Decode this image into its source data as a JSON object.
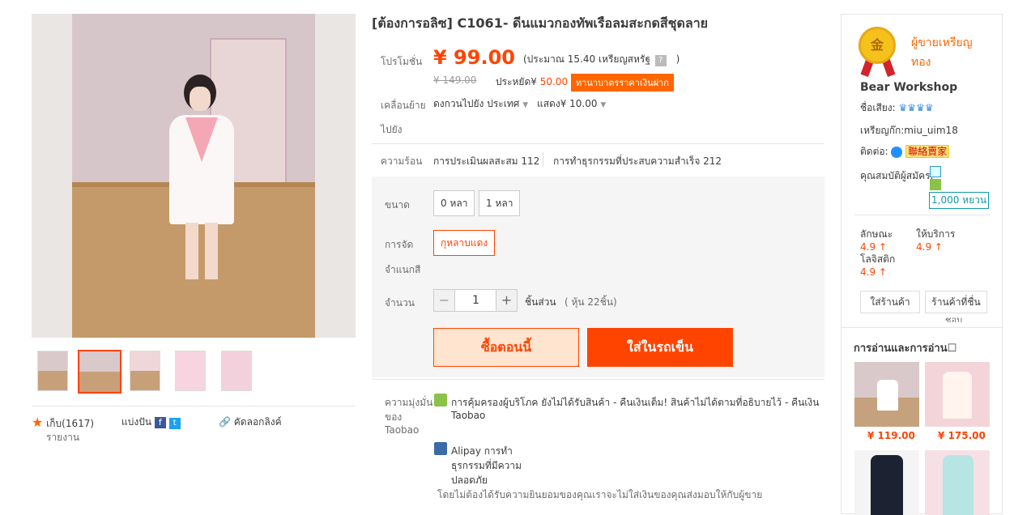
{
  "title": "[ต้องการอลิซ] C1061- ดีนแมวกองทัพเรือลมสะกดสีชุดลาย",
  "price": {
    "promo_label": "โปรโมชั่น",
    "current": "¥ 99.00",
    "approx": "(ประมาณ 15.40 เหรียญสหรัฐ",
    "approx_close": ")",
    "help": "?",
    "original": "¥ 149.00",
    "save_label": "ประหยัด¥",
    "save_value": "50.00",
    "deposit_tag": "ทานาบาตรราคาเงินฝาก"
  },
  "shipping": {
    "label": "เคลื่อนย้าย",
    "label2": "ไปยัง",
    "dest": "ดงกวนไปยัง ประเทศ",
    "fee": "แสดง¥ 10.00"
  },
  "popularity": {
    "label": "ความร้อน",
    "reviews": "การประเมินผลสะสม 112",
    "sales": "การทำธุรกรรมที่ประสบความสำเร็จ 212"
  },
  "sku": {
    "size_label": "ขนาด",
    "sizes": [
      "0 หลา",
      "1 หลา"
    ],
    "color_label": "การจัด",
    "color_label2": "จำแนกสี",
    "color_value": "กุหลาบแดง",
    "qty_label": "จำนวน",
    "qty_value": "1",
    "qty_minus": "−",
    "qty_plus": "+",
    "unit": "ชิ้นส่วน",
    "stock": "( หุ้น 22ชิ้น)"
  },
  "buttons": {
    "buy_now": "ซื้อตอนนี้",
    "add_cart": "ใส่ในรถเข็น"
  },
  "promise": {
    "label1": "ความมุ่งมั่น",
    "label2": "ของ",
    "label3": "Taobao",
    "item1": "การคุ้มครองผู้บริโภค   ยังไม่ได้รับสินค้า - คืนเงินเต็ม! สินค้าไม่ได้ตามที่อธิบายไว้ - คืนเงิน",
    "item1b": "Taobao",
    "item2a": "Alipay การทำ",
    "item2b": "ธุรกรรมที่มีความ",
    "item2c": "ปลอดภัย",
    "note": "โดยไม่ต้องได้รับความยินยอมของคุณเราจะไม่ใส่เงินของคุณส่งมอบให้กับผู้ขาย"
  },
  "share": {
    "collect": "เก็บ(1617)",
    "report": "รายงาน",
    "share": "แบ่งปัน",
    "copy": "คัดลอกลิงค์"
  },
  "seller": {
    "medal": "金",
    "level": "ผู้ขายเหรียญ",
    "level2": "ทอง",
    "name": "Bear Workshop",
    "reputation_label": "ชื่อเสียง:",
    "id_label": "เหรียญก๊ก:",
    "id": "miu_uim18",
    "contact_label": "ติดต่อ:",
    "contact_btn": "聯絡賣家",
    "membership_label": "คุณสมบัติผู้สมัคร:",
    "deposit": "1,000 หยวน",
    "score1_label": "ลักษณะ",
    "score1": "4.9",
    "score2_label": "ให้บริการ",
    "score2": "4.9",
    "score3_label": "โลจิสติก",
    "score3": "4.9",
    "enter_shop": "ใส่ร้านค้า",
    "fav_shop": "ร้านค้าที่ชื่น",
    "fav_shop2": "ชอบ"
  },
  "recommend": {
    "title": "การอ่านและการอ่าน☐",
    "prices": [
      "¥ 119.00",
      "¥ 175.00"
    ]
  },
  "colors": {
    "accent": "#ff4400",
    "orange": "#ff6600",
    "blue": "#3366cc"
  }
}
